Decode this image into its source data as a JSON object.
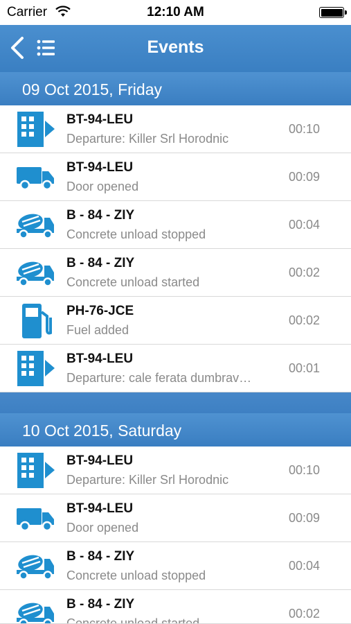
{
  "status": {
    "carrier": "Carrier",
    "time": "12:10 AM"
  },
  "nav": {
    "title": "Events",
    "back_icon": "chevron-left-icon",
    "list_icon": "list-icon"
  },
  "colors": {
    "accent": "#3a7fc2",
    "icon": "#1f8fcf",
    "secondary_text": "#8a8a8a"
  },
  "sections": [
    {
      "header": "09 Oct 2015, Friday",
      "events": [
        {
          "icon": "building-departure-icon",
          "plate": "BT-94-LEU",
          "description": "Departure: Killer Srl Horodnic",
          "time": "00:10"
        },
        {
          "icon": "truck-icon",
          "plate": "BT-94-LEU",
          "description": "Door opened",
          "time": "00:09"
        },
        {
          "icon": "concrete-mixer-icon",
          "plate": "B - 84 - ZIY",
          "description": "Concrete unload stopped",
          "time": "00:04"
        },
        {
          "icon": "concrete-mixer-icon",
          "plate": "B - 84 - ZIY",
          "description": "Concrete unload started",
          "time": "00:02"
        },
        {
          "icon": "fuel-pump-icon",
          "plate": "PH-76-JCE",
          "description": "Fuel added",
          "time": "00:02"
        },
        {
          "icon": "building-departure-icon",
          "plate": "BT-94-LEU",
          "description": "Departure: cale ferata dumbrav…",
          "time": "00:01"
        }
      ]
    },
    {
      "header": "10 Oct 2015, Saturday",
      "events": [
        {
          "icon": "building-departure-icon",
          "plate": "BT-94-LEU",
          "description": "Departure: Killer Srl Horodnic",
          "time": "00:10"
        },
        {
          "icon": "truck-icon",
          "plate": "BT-94-LEU",
          "description": "Door opened",
          "time": "00:09"
        },
        {
          "icon": "concrete-mixer-icon",
          "plate": "B - 84 - ZIY",
          "description": "Concrete unload stopped",
          "time": "00:04"
        },
        {
          "icon": "concrete-mixer-icon",
          "plate": "B - 84 - ZIY",
          "description": "Concrete unload started",
          "time": "00:02"
        }
      ]
    }
  ]
}
